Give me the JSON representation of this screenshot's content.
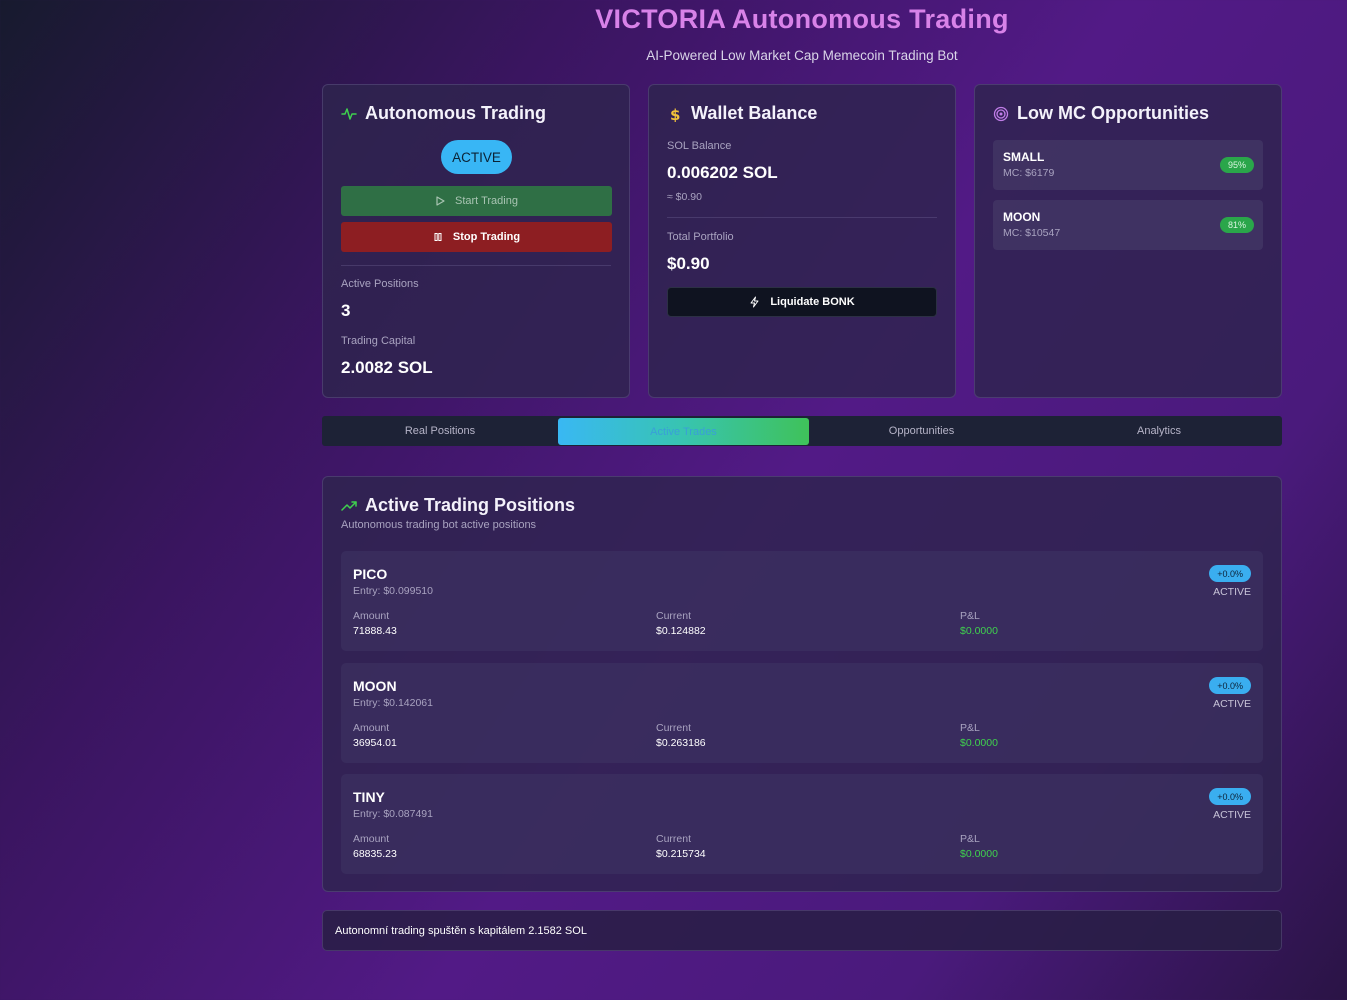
{
  "header": {
    "title": "VICTORIA Autonomous Trading",
    "subtitle": "AI-Powered Low Market Cap Memecoin Trading Bot"
  },
  "trading": {
    "title": "Autonomous Trading",
    "status": "ACTIVE",
    "start_label": "Start Trading",
    "stop_label": "Stop Trading",
    "positions_label": "Active Positions",
    "positions_value": "3",
    "capital_label": "Trading Capital",
    "capital_value": "2.0082 SOL"
  },
  "wallet": {
    "title": "Wallet Balance",
    "sol_label": "SOL Balance",
    "sol_value": "0.006202 SOL",
    "sol_usd": "≈ $0.90",
    "portfolio_label": "Total Portfolio",
    "portfolio_value": "$0.90",
    "liquidate_label": "Liquidate BONK"
  },
  "opportunities": {
    "title": "Low MC Opportunities",
    "items": [
      {
        "name": "SMALL",
        "mc": "MC: $6179",
        "score": "95%"
      },
      {
        "name": "MOON",
        "mc": "MC: $10547",
        "score": "81%"
      }
    ]
  },
  "tabs": [
    {
      "label": "Real Positions"
    },
    {
      "label": "Active Trades"
    },
    {
      "label": "Opportunities"
    },
    {
      "label": "Analytics"
    }
  ],
  "positions": {
    "title": "Active Trading Positions",
    "subtitle": "Autonomous trading bot active positions",
    "amount_label": "Amount",
    "current_label": "Current",
    "pnl_label": "P&L",
    "rows": [
      {
        "symbol": "PICO",
        "entry": "Entry: $0.099510",
        "change": "+0.0%",
        "status": "ACTIVE",
        "amount": "71888.43",
        "current": "$0.124882",
        "pnl": "$0.0000"
      },
      {
        "symbol": "MOON",
        "entry": "Entry: $0.142061",
        "change": "+0.0%",
        "status": "ACTIVE",
        "amount": "36954.01",
        "current": "$0.263186",
        "pnl": "$0.0000"
      },
      {
        "symbol": "TINY",
        "entry": "Entry: $0.087491",
        "change": "+0.0%",
        "status": "ACTIVE",
        "amount": "68835.23",
        "current": "$0.215734",
        "pnl": "$0.0000"
      }
    ]
  },
  "log": {
    "message": "Autonomní trading spuštěn s kapitálem 2.1582 SOL"
  },
  "colors": {
    "accent_pink": "#d882e8",
    "active_blue": "#38b6f5",
    "start_green": "#2f6f45",
    "stop_red": "#8d1e22",
    "pnl_green": "#3fd04e"
  },
  "icons": {
    "trading": "activity-icon",
    "wallet": "dollar-icon",
    "opportunities": "target-icon",
    "positions": "trending-up-icon",
    "start": "play-icon",
    "stop": "pause-icon",
    "liquidate": "zap-icon"
  }
}
